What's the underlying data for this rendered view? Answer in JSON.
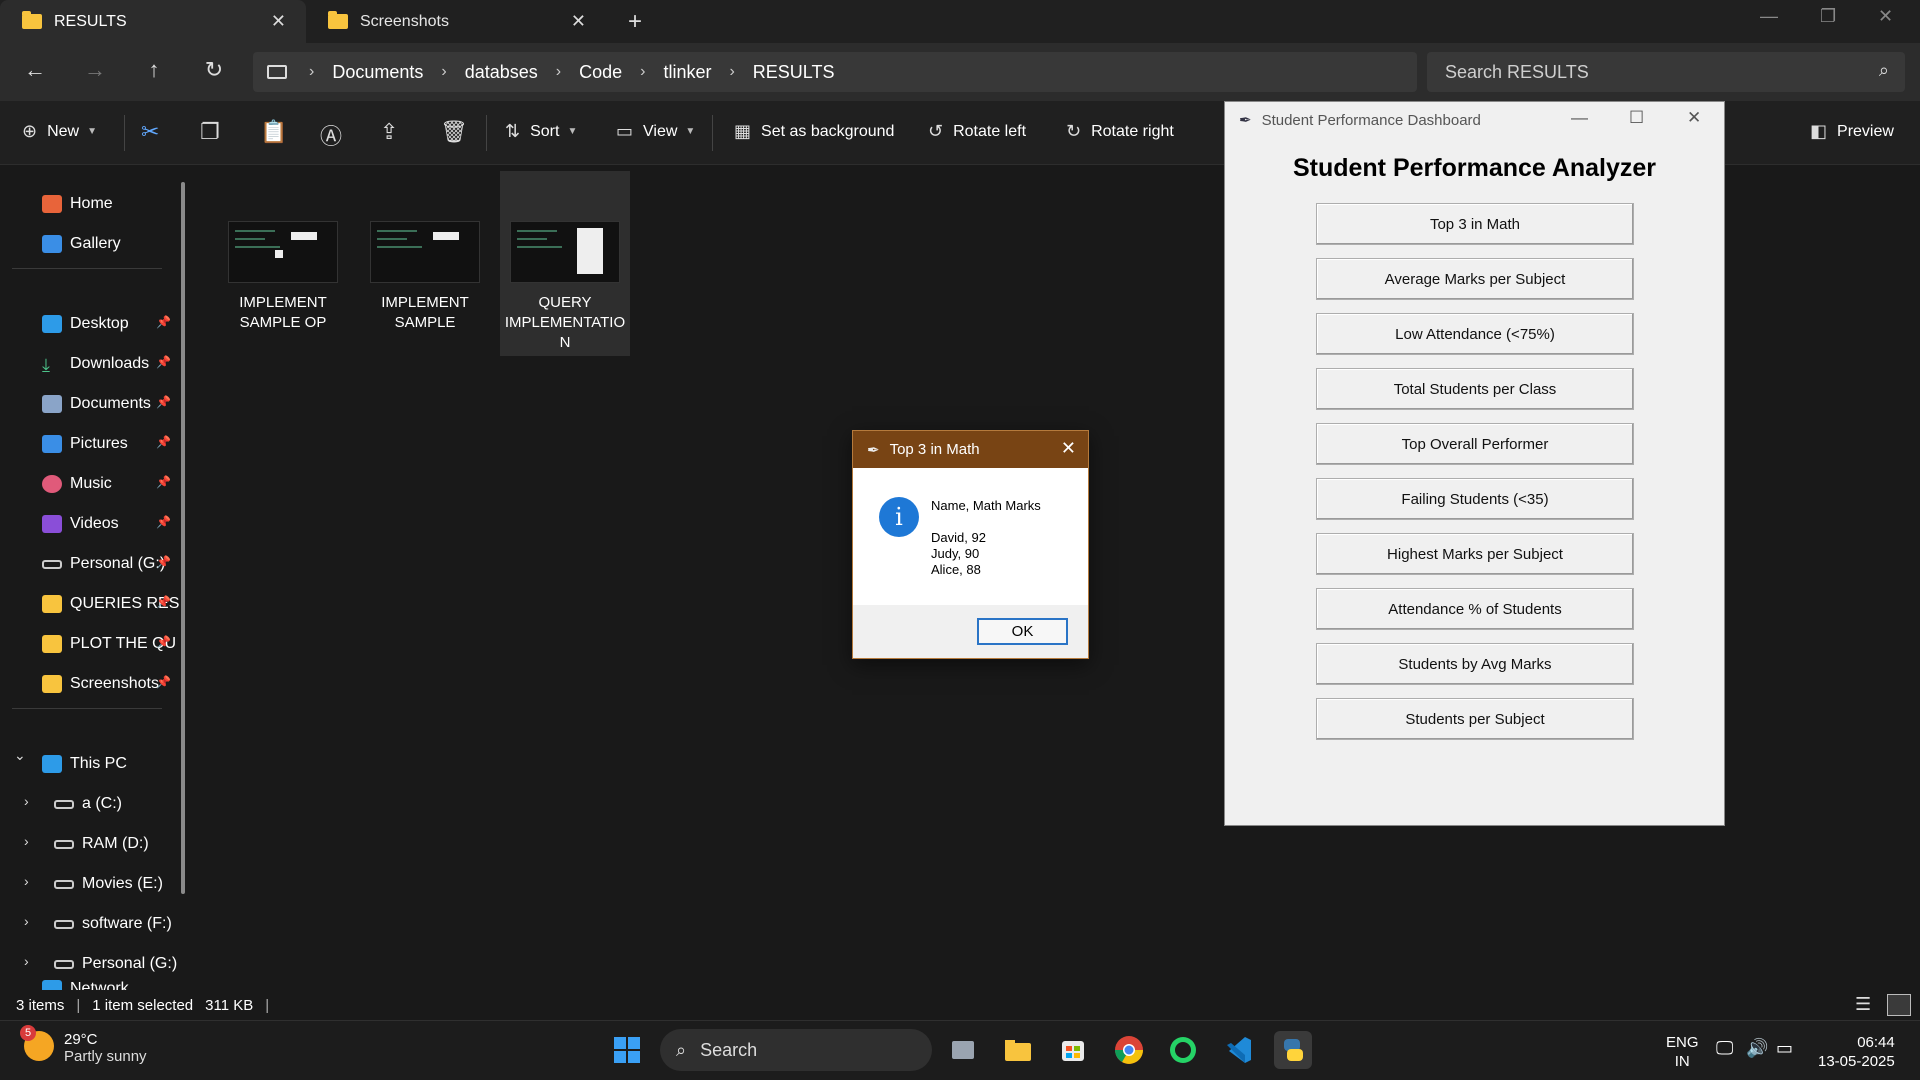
{
  "tabs": [
    {
      "label": "RESULTS"
    },
    {
      "label": "Screenshots"
    }
  ],
  "breadcrumb": [
    "Documents",
    "databses",
    "Code",
    "tlinker",
    "RESULTS"
  ],
  "search_placeholder": "Search RESULTS",
  "commands": {
    "new": "New",
    "sort": "Sort",
    "view": "View",
    "set_background": "Set as background",
    "rotate_left": "Rotate left",
    "rotate_right": "Rotate right",
    "preview": "Preview"
  },
  "sidebar": {
    "top": [
      "Home",
      "Gallery"
    ],
    "pinned": [
      "Desktop",
      "Downloads",
      "Documents",
      "Pictures",
      "Music",
      "Videos",
      "Personal (G:)",
      "QUERIES RES",
      "PLOT THE QU",
      "Screenshots"
    ],
    "this_pc": "This PC",
    "drives": [
      "a (C:)",
      "RAM (D:)",
      "Movies (E:)",
      "software (F:)",
      "Personal (G:)"
    ],
    "network": "Network"
  },
  "files": [
    {
      "name_line1": "IMPLEMENT",
      "name_line2": "SAMPLE OP",
      "name_line3": ""
    },
    {
      "name_line1": "IMPLEMENT",
      "name_line2": "SAMPLE",
      "name_line3": ""
    },
    {
      "name_line1": "QUERY",
      "name_line2": "IMPLEMENTATIO",
      "name_line3": "N"
    }
  ],
  "status": {
    "count": "3 items",
    "selected": "1 item selected",
    "size": "311 KB"
  },
  "dashboard": {
    "window_title": "Student Performance Dashboard",
    "heading": "Student Performance Analyzer",
    "buttons": [
      "Top 3 in Math",
      "Average Marks per Subject",
      "Low Attendance (<75%)",
      "Total Students per Class",
      "Top Overall Performer",
      "Failing Students (<35)",
      "Highest Marks per Subject",
      "Attendance % of Students",
      "Students by Avg Marks",
      "Students per Subject"
    ]
  },
  "message": {
    "title": "Top 3 in Math",
    "heading": "Name, Math Marks",
    "rows": [
      "David, 92",
      "Judy, 90",
      "Alice, 88"
    ],
    "ok": "OK"
  },
  "taskbar": {
    "weather_temp": "29°C",
    "weather_desc": "Partly sunny",
    "weather_badge": "5",
    "search": "Search",
    "lang1": "ENG",
    "lang2": "IN",
    "time": "06:44",
    "date": "13-05-2025"
  },
  "colors": {
    "folder": "#f8c43e",
    "accent": "#1e78d6",
    "msg_titlebar": "#784414"
  }
}
